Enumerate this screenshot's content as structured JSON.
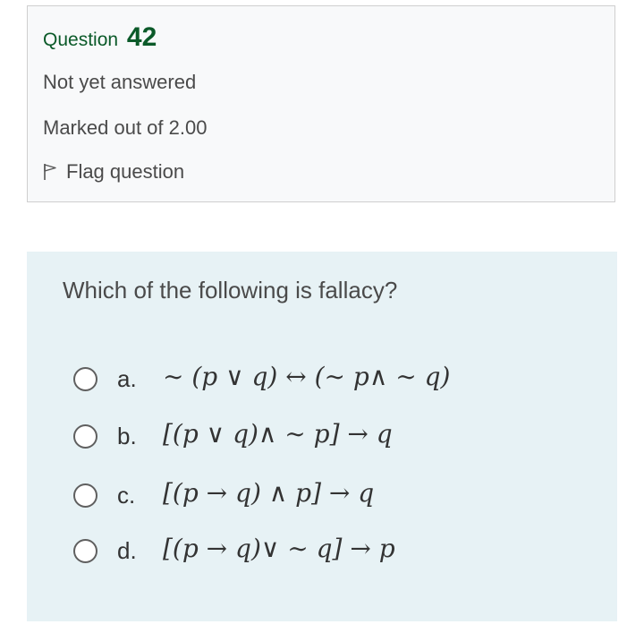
{
  "question_info": {
    "label": "Question",
    "number": "42",
    "status": "Not yet answered",
    "marks": "Marked out of 2.00",
    "flag_label": "Flag question"
  },
  "question": {
    "text": "Which of the following is fallacy?",
    "options": [
      {
        "letter": "a.",
        "formula": "∼ (p ∨ q) ↔ (∼ p∧ ∼ q)",
        "selected": false
      },
      {
        "letter": "b.",
        "formula": "[(p ∨ q)∧ ∼ p] → q",
        "selected": false
      },
      {
        "letter": "c.",
        "formula": "[(p → q) ∧ p] → q",
        "selected": false
      },
      {
        "letter": "d.",
        "formula": "[(p → q)∨ ∼ q] → p",
        "selected": false
      }
    ]
  },
  "colors": {
    "question_title": "#0b5a29",
    "info_background": "#f8f9fa",
    "question_background": "#e7f2f5"
  },
  "icons": {
    "flag": "flag-outline-icon",
    "radio": "radio-unchecked-icon"
  }
}
